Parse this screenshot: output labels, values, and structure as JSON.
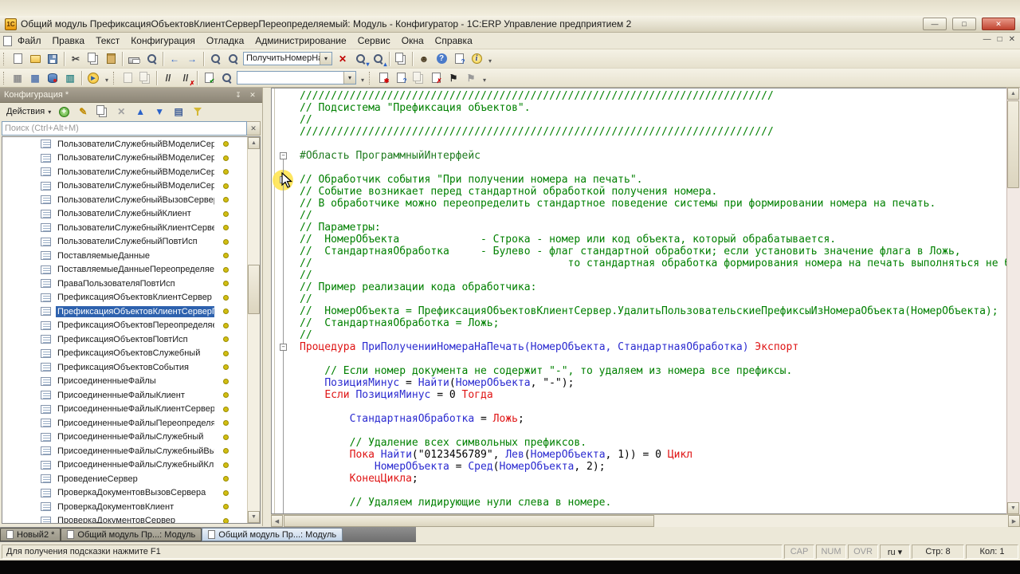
{
  "colors": {
    "selection": "#2e62ae",
    "comment": "#008000",
    "keyword": "#df1414",
    "identifier": "#2b2bd0",
    "directive": "#1e7a1e",
    "plain": "#000000",
    "dot": "#d2be12",
    "halo": "#ffe44d"
  },
  "window": {
    "app_icon_text": "1С",
    "title": "Общий модуль ПрефиксацияОбъектовКлиентСерверПереопределяемый: Модуль - Конфигуратор - 1C:ERP Управление предприятием 2",
    "minimize": "—",
    "maximize": "□",
    "close": "✕"
  },
  "menu": {
    "items": [
      "Файл",
      "Правка",
      "Текст",
      "Конфигурация",
      "Отладка",
      "Администрирование",
      "Сервис",
      "Окна",
      "Справка"
    ]
  },
  "toolbar_main": {
    "items": [
      {
        "t": "handle"
      },
      {
        "n": "new-document",
        "k": "page"
      },
      {
        "n": "open-document",
        "k": "folder"
      },
      {
        "n": "save-document",
        "k": "floppy"
      },
      {
        "t": "sep"
      },
      {
        "n": "cut",
        "k": "glyph",
        "g": "✂",
        "c": "#444444"
      },
      {
        "n": "copy",
        "k": "pages"
      },
      {
        "n": "paste",
        "k": "clip"
      },
      {
        "t": "sep"
      },
      {
        "n": "print",
        "k": "print"
      },
      {
        "n": "print-preview",
        "k": "mag"
      },
      {
        "t": "sep"
      },
      {
        "n": "navigate-back",
        "k": "glyph",
        "g": "←",
        "c": "#2a62c9"
      },
      {
        "n": "navigate-forward",
        "k": "glyph",
        "g": "→",
        "c": "#2a62c9"
      },
      {
        "t": "sep"
      },
      {
        "n": "global-search",
        "k": "mag"
      },
      {
        "n": "find",
        "k": "mag"
      },
      {
        "t": "combo",
        "n": "search-combobox",
        "v": "ПолучитьНомерНаПеч",
        "w": 112
      },
      {
        "n": "clear-search",
        "k": "glyph",
        "g": "✕",
        "c": "#c00000"
      },
      {
        "n": "find-next",
        "k": "mag",
        "b": "▾",
        "bc": "#2a62c9"
      },
      {
        "n": "find-previous",
        "k": "mag",
        "b": "▴",
        "bc": "#2a62c9"
      },
      {
        "t": "sep"
      },
      {
        "n": "copy-fragment",
        "k": "pages"
      },
      {
        "t": "sep"
      },
      {
        "n": "syntax-assistant",
        "k": "glyph",
        "g": "☻",
        "c": "#4a3b22"
      },
      {
        "n": "context-help",
        "k": "qcirc",
        "g": "?"
      },
      {
        "n": "help-contents",
        "k": "page",
        "b": "?",
        "bc": "#2a62c9"
      },
      {
        "n": "about-info",
        "k": "info",
        "g": "i"
      },
      {
        "t": "drop"
      }
    ]
  },
  "toolbar_module": {
    "items": [
      {
        "t": "handle"
      },
      {
        "n": "locals-grid",
        "k": "glyph",
        "g": "▦",
        "c": "#909090"
      },
      {
        "n": "open-form",
        "k": "glyph",
        "g": "▦",
        "c": "#5a7ab0"
      },
      {
        "n": "database-config",
        "k": "db"
      },
      {
        "n": "table-view",
        "k": "glyph",
        "g": "▥",
        "c": "#3a8a8a"
      },
      {
        "t": "sep"
      },
      {
        "n": "start-debugging",
        "k": "play",
        "g": "▶"
      },
      {
        "t": "drop"
      },
      {
        "t": "handle"
      },
      {
        "n": "format-block",
        "k": "page",
        "d": true
      },
      {
        "n": "shift-block",
        "k": "pages",
        "d": true
      },
      {
        "t": "sep"
      },
      {
        "n": "add-comment",
        "k": "glyph",
        "g": "//",
        "c": "#333333"
      },
      {
        "n": "remove-comment",
        "k": "glyph",
        "g": "//",
        "c": "#333333",
        "b": "✗",
        "bc": "#d00000"
      },
      {
        "t": "sep"
      },
      {
        "n": "check-module",
        "k": "page",
        "b": "✔",
        "bc": "#0a8a0a"
      },
      {
        "n": "procedures-list",
        "k": "mag"
      },
      {
        "t": "combo",
        "n": "procedure-combobox",
        "v": "",
        "w": 150
      },
      {
        "t": "drop"
      },
      {
        "t": "handle"
      },
      {
        "n": "new-template",
        "k": "page",
        "b": "✱",
        "bc": "#d00000"
      },
      {
        "n": "template-help",
        "k": "page",
        "b": "?",
        "bc": "#2a62c9"
      },
      {
        "n": "templates-list",
        "k": "pages",
        "d": true
      },
      {
        "n": "delete-template",
        "k": "page",
        "b": "✗",
        "bc": "#d00000"
      },
      {
        "n": "run-to-cursor-flag",
        "k": "glyph",
        "g": "⚑",
        "c": "#222222"
      },
      {
        "n": "breakpoint-flag",
        "k": "glyph",
        "g": "⚑",
        "c": "#999999"
      },
      {
        "t": "drop"
      }
    ]
  },
  "config_panel": {
    "title": "Конфигурация *",
    "pin": "↧",
    "close": "✕",
    "actions_label": "Действия",
    "actions": [
      {
        "n": "add",
        "k": "cplus",
        "g": "+"
      },
      {
        "n": "edit",
        "k": "glyph",
        "g": "✎",
        "c": "#c08a00"
      },
      {
        "n": "duplicate",
        "k": "pages"
      },
      {
        "n": "delete",
        "k": "glyph",
        "g": "✕",
        "c": "#a0a0a0"
      },
      {
        "n": "move-up",
        "k": "glyph",
        "g": "▲",
        "c": "#2a62c9"
      },
      {
        "n": "move-down",
        "k": "glyph",
        "g": "▼",
        "c": "#2a62c9"
      },
      {
        "n": "list-settings",
        "k": "glyph",
        "g": "▤",
        "c": "#44629a"
      },
      {
        "n": "filter",
        "k": "funnel"
      }
    ],
    "search_placeholder": "Поиск (Ctrl+Alt+M)",
    "selected_index": 12,
    "items": [
      "ПользователиСлужебныйВМоделиСерви...",
      "ПользователиСлужебныйВМоделиСерви...",
      "ПользователиСлужебныйВМоделиСерви...",
      "ПользователиСлужебныйВМоделиСерви...",
      "ПользователиСлужебныйВызовСервера",
      "ПользователиСлужебныйКлиент",
      "ПользователиСлужебныйКлиентСервер",
      "ПользователиСлужебныйПовтИсп",
      "ПоставляемыеДанные",
      "ПоставляемыеДанныеПереопределяемый",
      "ПраваПользователяПовтИсп",
      "ПрефиксацияОбъектовКлиентСервер",
      "ПрефиксацияОбъектовКлиентСерверПер...",
      "ПрефиксацияОбъектовПереопределяемый",
      "ПрефиксацияОбъектовПовтИсп",
      "ПрефиксацияОбъектовСлужебный",
      "ПрефиксацияОбъектовСобытия",
      "ПрисоединенныеФайлы",
      "ПрисоединенныеФайлыКлиент",
      "ПрисоединенныеФайлыКлиентСервер",
      "ПрисоединенныеФайлыПереопределяем...",
      "ПрисоединенныеФайлыСлужебный",
      "ПрисоединенныеФайлыСлужебныйВызо...",
      "ПрисоединенныеФайлыСлужебныйКлиент",
      "ПроведениеСервер",
      "ПроверкаДокументовВызовСервера",
      "ПроверкаДокументовКлиент",
      "ПроверкаДокументовСервер"
    ]
  },
  "editor": {
    "lines": [
      {
        "s": [
          [
            "cm",
            "////////////////////////////////////////////////////////////////////////////"
          ]
        ]
      },
      {
        "s": [
          [
            "cm",
            "// Подсистема \"Префиксация объектов\"."
          ]
        ]
      },
      {
        "s": [
          [
            "cm",
            "//"
          ]
        ]
      },
      {
        "s": [
          [
            "cm",
            "////////////////////////////////////////////////////////////////////////////"
          ]
        ]
      },
      {
        "s": []
      },
      {
        "f": 1,
        "s": [
          [
            "dir",
            "#Область ПрограммныйИнтерфейс"
          ]
        ]
      },
      {
        "s": []
      },
      {
        "f": 1,
        "cur": 1,
        "s": [
          [
            "cm",
            "// Обработчик события \"При получении номера на печать\"."
          ]
        ]
      },
      {
        "s": [
          [
            "cm",
            "// Событие возникает перед стандартной обработкой получения номера."
          ]
        ]
      },
      {
        "s": [
          [
            "cm",
            "// В обработчике можно переопределить стандартное поведение системы при формировании номера на печать."
          ]
        ]
      },
      {
        "s": [
          [
            "cm",
            "//"
          ]
        ]
      },
      {
        "s": [
          [
            "cm",
            "// Параметры:"
          ]
        ]
      },
      {
        "s": [
          [
            "cm",
            "//  НомерОбъекта             - Строка - номер или код объекта, который обрабатывается."
          ]
        ]
      },
      {
        "s": [
          [
            "cm",
            "//  СтандартнаяОбработка     - Булево - флаг стандартной обработки; если установить значение флага в Ложь,"
          ]
        ]
      },
      {
        "s": [
          [
            "cm",
            "//                                         то стандартная обработка формирования номера на печать выполняться не будет."
          ]
        ]
      },
      {
        "s": [
          [
            "cm",
            "//"
          ]
        ]
      },
      {
        "s": [
          [
            "cm",
            "// Пример реализации кода обработчика:"
          ]
        ]
      },
      {
        "s": [
          [
            "cm",
            "//"
          ]
        ]
      },
      {
        "s": [
          [
            "cm",
            "//  НомерОбъекта = ПрефиксацияОбъектовКлиентСервер.УдалитьПользовательскиеПрефиксыИзНомераОбъекта(НомерОбъекта);"
          ]
        ]
      },
      {
        "s": [
          [
            "cm",
            "//  СтандартнаяОбработка = Ложь;"
          ]
        ]
      },
      {
        "s": [
          [
            "cm",
            "//"
          ]
        ]
      },
      {
        "f": 1,
        "s": [
          [
            "kw",
            "Процедура"
          ],
          [
            "tx",
            " "
          ],
          [
            "id",
            "ПриПолученииНомераНаПечать(НомерОбъекта, СтандартнаяОбработка)"
          ],
          [
            "tx",
            " "
          ],
          [
            "kw",
            "Экспорт"
          ]
        ]
      },
      {
        "s": []
      },
      {
        "s": [
          [
            "cm",
            "    // Если номер документа не содержит \"-\", то удаляем из номера все префиксы."
          ]
        ]
      },
      {
        "s": [
          [
            "tx",
            "    "
          ],
          [
            "id",
            "ПозицияМинус"
          ],
          [
            "tx",
            " = "
          ],
          [
            "id",
            "Найти"
          ],
          [
            "tx",
            "("
          ],
          [
            "id",
            "НомерОбъекта"
          ],
          [
            "tx",
            ", \"-\");"
          ]
        ]
      },
      {
        "s": [
          [
            "tx",
            "    "
          ],
          [
            "kw",
            "Если"
          ],
          [
            "tx",
            " "
          ],
          [
            "id",
            "ПозицияМинус"
          ],
          [
            "tx",
            " = 0 "
          ],
          [
            "kw",
            "Тогда"
          ]
        ]
      },
      {
        "s": []
      },
      {
        "s": [
          [
            "tx",
            "        "
          ],
          [
            "id",
            "СтандартнаяОбработка"
          ],
          [
            "tx",
            " = "
          ],
          [
            "kw",
            "Ложь"
          ],
          [
            "tx",
            ";"
          ]
        ]
      },
      {
        "s": []
      },
      {
        "s": [
          [
            "cm",
            "        // Удаление всех символьных префиксов."
          ]
        ]
      },
      {
        "s": [
          [
            "tx",
            "        "
          ],
          [
            "kw",
            "Пока"
          ],
          [
            "tx",
            " "
          ],
          [
            "id",
            "Найти"
          ],
          [
            "tx",
            "(\"0123456789\", "
          ],
          [
            "id",
            "Лев"
          ],
          [
            "tx",
            "("
          ],
          [
            "id",
            "НомерОбъекта"
          ],
          [
            "tx",
            ", 1)) = 0 "
          ],
          [
            "kw",
            "Цикл"
          ]
        ]
      },
      {
        "s": [
          [
            "tx",
            "            "
          ],
          [
            "id",
            "НомерОбъекта"
          ],
          [
            "tx",
            " = "
          ],
          [
            "id",
            "Сред"
          ],
          [
            "tx",
            "("
          ],
          [
            "id",
            "НомерОбъекта"
          ],
          [
            "tx",
            ", 2);"
          ]
        ]
      },
      {
        "s": [
          [
            "tx",
            "        "
          ],
          [
            "kw",
            "КонецЦикла"
          ],
          [
            "tx",
            ";"
          ]
        ]
      },
      {
        "s": []
      },
      {
        "s": [
          [
            "cm",
            "        // Удаляем лидирующие нули слева в номере."
          ]
        ]
      }
    ]
  },
  "window_tabs": [
    {
      "label": "Новый2 *"
    },
    {
      "label": "Общий модуль Пр...: Модуль"
    },
    {
      "label": "Общий модуль Пр...: Модуль",
      "active": true
    }
  ],
  "status_bar": {
    "hint": "Для получения подсказки нажмите F1",
    "cells": [
      {
        "text": "CAP",
        "muted": true
      },
      {
        "text": "NUM",
        "muted": true
      },
      {
        "text": "OVR",
        "muted": true
      },
      {
        "text": "ru",
        "dropdown": true
      },
      {
        "text": "Стр: 8"
      },
      {
        "text": "Кол: 1"
      }
    ]
  }
}
